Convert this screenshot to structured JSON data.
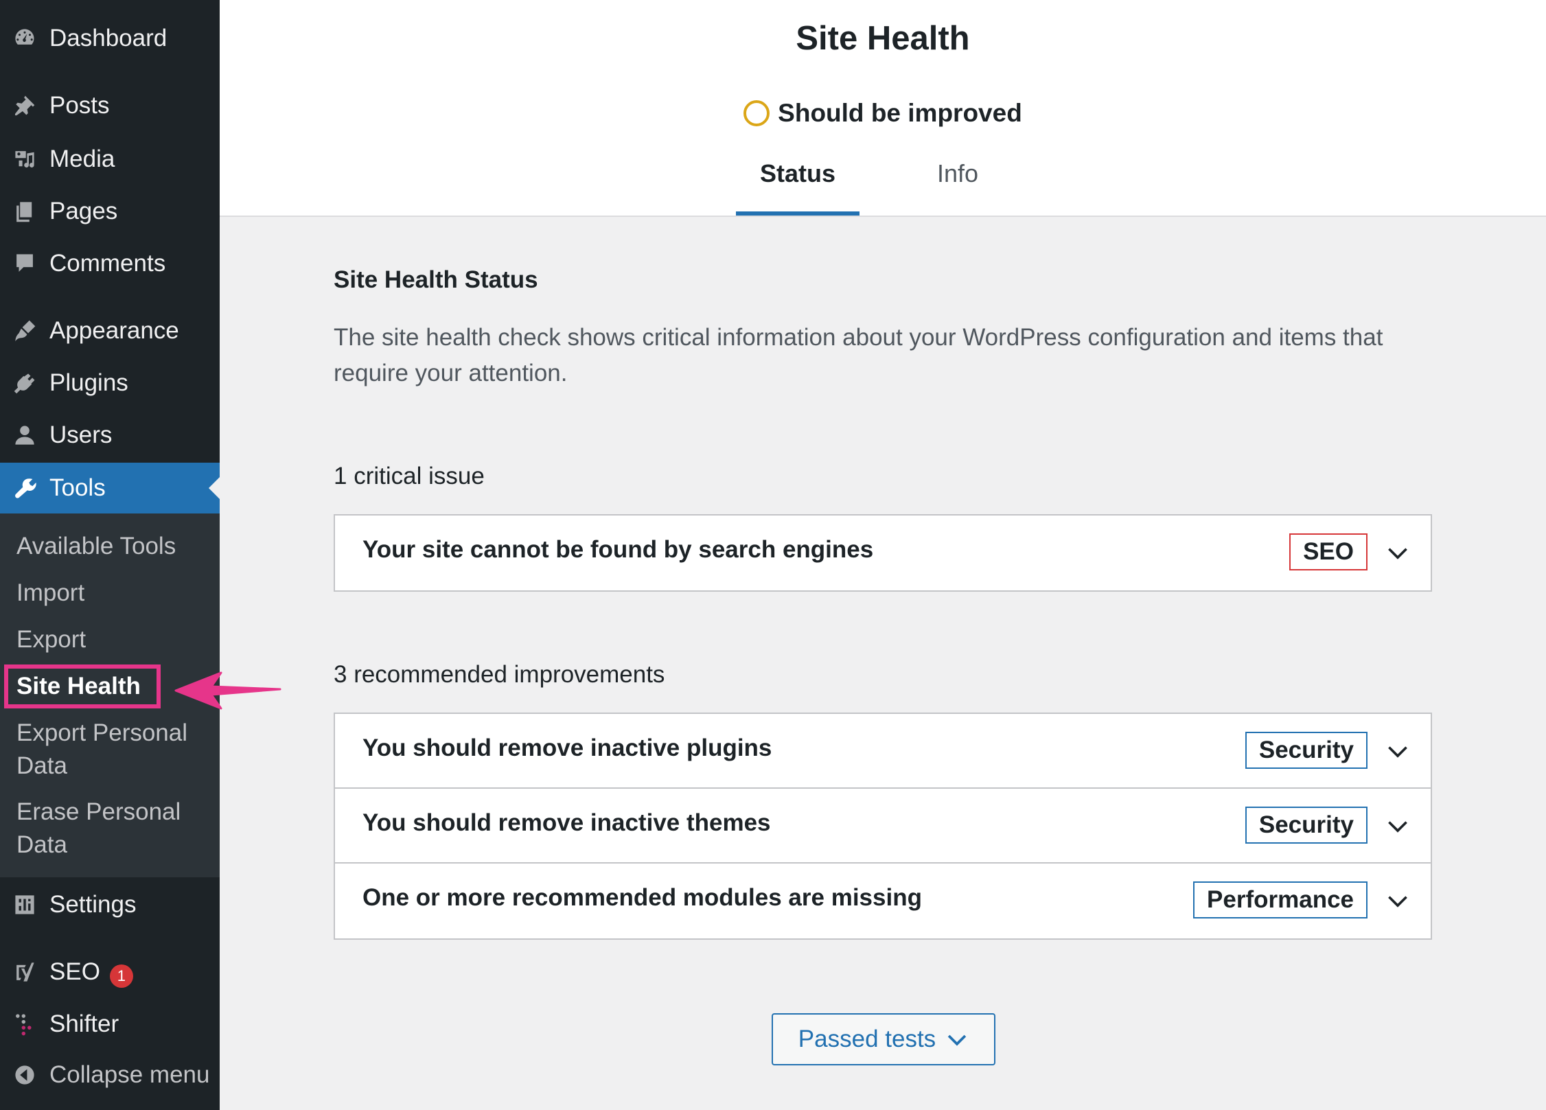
{
  "sidebar": {
    "items": [
      {
        "label": "Dashboard",
        "icon": "dashboard-icon"
      },
      {
        "label": "Posts",
        "icon": "pin-icon"
      },
      {
        "label": "Media",
        "icon": "media-icon"
      },
      {
        "label": "Pages",
        "icon": "pages-icon"
      },
      {
        "label": "Comments",
        "icon": "comment-icon"
      },
      {
        "label": "Appearance",
        "icon": "brush-icon"
      },
      {
        "label": "Plugins",
        "icon": "plug-icon"
      },
      {
        "label": "Users",
        "icon": "user-icon"
      },
      {
        "label": "Tools",
        "icon": "wrench-icon"
      },
      {
        "label": "Settings",
        "icon": "settings-icon"
      },
      {
        "label": "SEO",
        "icon": "yoast-icon",
        "badge": "1"
      },
      {
        "label": "Shifter",
        "icon": "shifter-icon"
      },
      {
        "label": "Collapse menu",
        "icon": "collapse-icon"
      }
    ],
    "submenu": [
      {
        "label": "Available Tools"
      },
      {
        "label": "Import"
      },
      {
        "label": "Export"
      },
      {
        "label": "Site Health"
      },
      {
        "label": "Export Personal\nData"
      },
      {
        "label": "Erase Personal\nData"
      }
    ]
  },
  "header": {
    "title": "Site Health",
    "status": "Should be improved",
    "tabs": [
      {
        "label": "Status"
      },
      {
        "label": "Info"
      }
    ]
  },
  "main": {
    "section_title": "Site Health Status",
    "description": "The site health check shows critical information about your WordPress configuration and items that require your attention.",
    "critical_heading": "1 critical issue",
    "critical_issues": [
      {
        "title": "Your site cannot be found by search engines",
        "badge": "SEO"
      }
    ],
    "recommended_heading": "3 recommended improvements",
    "recommended_issues": [
      {
        "title": "You should remove inactive plugins",
        "badge": "Security"
      },
      {
        "title": "You should remove inactive themes",
        "badge": "Security"
      },
      {
        "title": "One or more recommended modules are missing",
        "badge": "Performance"
      }
    ],
    "passed_tests_label": "Passed tests"
  },
  "colors": {
    "sidebar_bg": "#1d2327",
    "submenu_bg": "#2c3338",
    "accent": "#2271b1",
    "critical": "#d63638",
    "status_ring": "#dba617",
    "highlight": "#e6358a"
  }
}
